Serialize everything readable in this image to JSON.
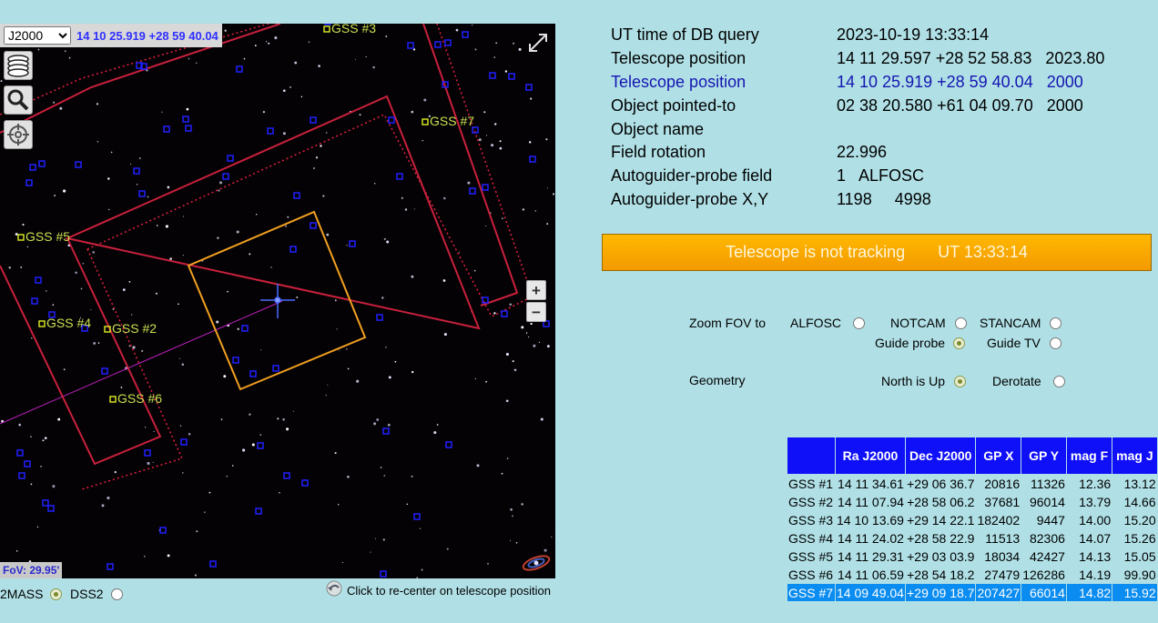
{
  "finder": {
    "epoch": "J2000",
    "epoch_options": [
      "J2000"
    ],
    "radec": "14 10 25.919 +28 59 40.04",
    "fov": "FoV: 29.95'",
    "zoom_in": "+",
    "zoom_out": "−",
    "gss_labels": [
      "GSS #3",
      "GSS #7",
      "GSS #5",
      "GSS #4",
      "GSS #2",
      "GSS #6"
    ]
  },
  "surveys": [
    {
      "label": "2MASS",
      "selected": true
    },
    {
      "label": "DSS2",
      "selected": false
    }
  ],
  "recenter_text": "Click to re-center on telescope position",
  "info": [
    {
      "label": "UT time of DB query",
      "value": "2023-10-19 13:33:14"
    },
    {
      "label": "Telescope position",
      "value": "14 11 29.597 +28 52 58.83   2023.80"
    },
    {
      "label": "Telescope position",
      "value": "14 10 25.919 +28 59 40.04   2000"
    },
    {
      "label": "Object pointed-to",
      "value": "02 38 20.580 +61 04 09.70   2000"
    },
    {
      "label": "Object name",
      "value": ""
    },
    {
      "label": "Field rotation",
      "value": "22.996"
    },
    {
      "label": "Autoguider-probe field",
      "value": "1   ALFOSC"
    },
    {
      "label": "Autoguider-probe X,Y",
      "value": "1198     4998"
    }
  ],
  "status": {
    "text": "Telescope is not tracking",
    "time": "UT 13:33:14",
    "color": "#ffb000"
  },
  "controls": {
    "zoom_label": "Zoom FOV to",
    "geometry_label": "Geometry",
    "alfosc": "ALFOSC",
    "notcam": "NOTCAM",
    "stancam": "STANCAM",
    "guide_probe": "Guide probe",
    "guide_tv": "Guide TV",
    "north_up": "North is Up",
    "derotate": "Derotate"
  },
  "table": {
    "headers": [
      "",
      "Ra J2000",
      "Dec J2000",
      "GP X",
      "GP Y",
      "mag F",
      "mag J"
    ],
    "rows": [
      [
        "GSS #1",
        "14 11 34.61",
        "+29 06 36.7",
        "20816",
        "11326",
        "12.36",
        "13.12"
      ],
      [
        "GSS #2",
        "14 11 07.94",
        "+28 58 06.2",
        "37681",
        "96014",
        "13.79",
        "14.66"
      ],
      [
        "GSS #3",
        "14 10 13.69",
        "+29 14 22.1",
        "182402",
        "9447",
        "14.00",
        "15.20"
      ],
      [
        "GSS #4",
        "14 11 24.02",
        "+28 58 22.9",
        "11513",
        "82306",
        "14.07",
        "15.26"
      ],
      [
        "GSS #5",
        "14 11 29.31",
        "+29 03 03.9",
        "18034",
        "42427",
        "14.13",
        "15.05"
      ],
      [
        "GSS #6",
        "14 11 06.59",
        "+28 54 18.2",
        "27479",
        "126286",
        "14.19",
        "99.90"
      ],
      [
        "GSS #7",
        "14 09 49.04",
        "+29 09 18.7",
        "207427",
        "66014",
        "14.82",
        "15.92"
      ]
    ]
  }
}
